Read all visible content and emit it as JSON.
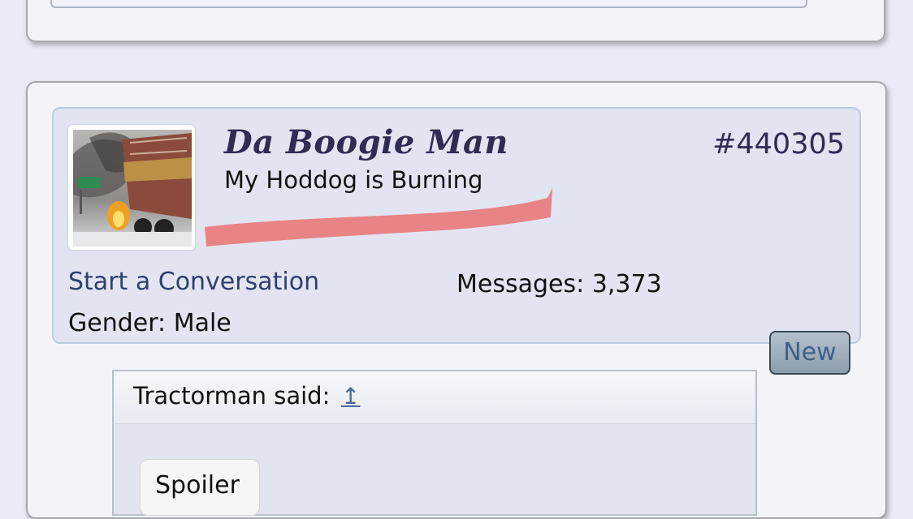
{
  "post": {
    "username": "Da Boogie Man",
    "user_title": "My Hoddog is Burning",
    "post_number": "#440305",
    "start_conversation": "Start a Conversation",
    "messages_label": "Messages:",
    "messages_value": "3,373",
    "gender_label": "Gender:",
    "gender_value": "Male",
    "new_badge": "New"
  },
  "quote": {
    "author": "Tractorman said:",
    "jump_icon": "↥",
    "spoiler_label": "Spoiler"
  },
  "colors": {
    "username": "#2e2d52",
    "link": "#2f3f6c",
    "redaction": "#e8787a",
    "panel_bg": "#e3e4f1"
  },
  "icons": {
    "quote_jump": "up-arrow-icon"
  }
}
